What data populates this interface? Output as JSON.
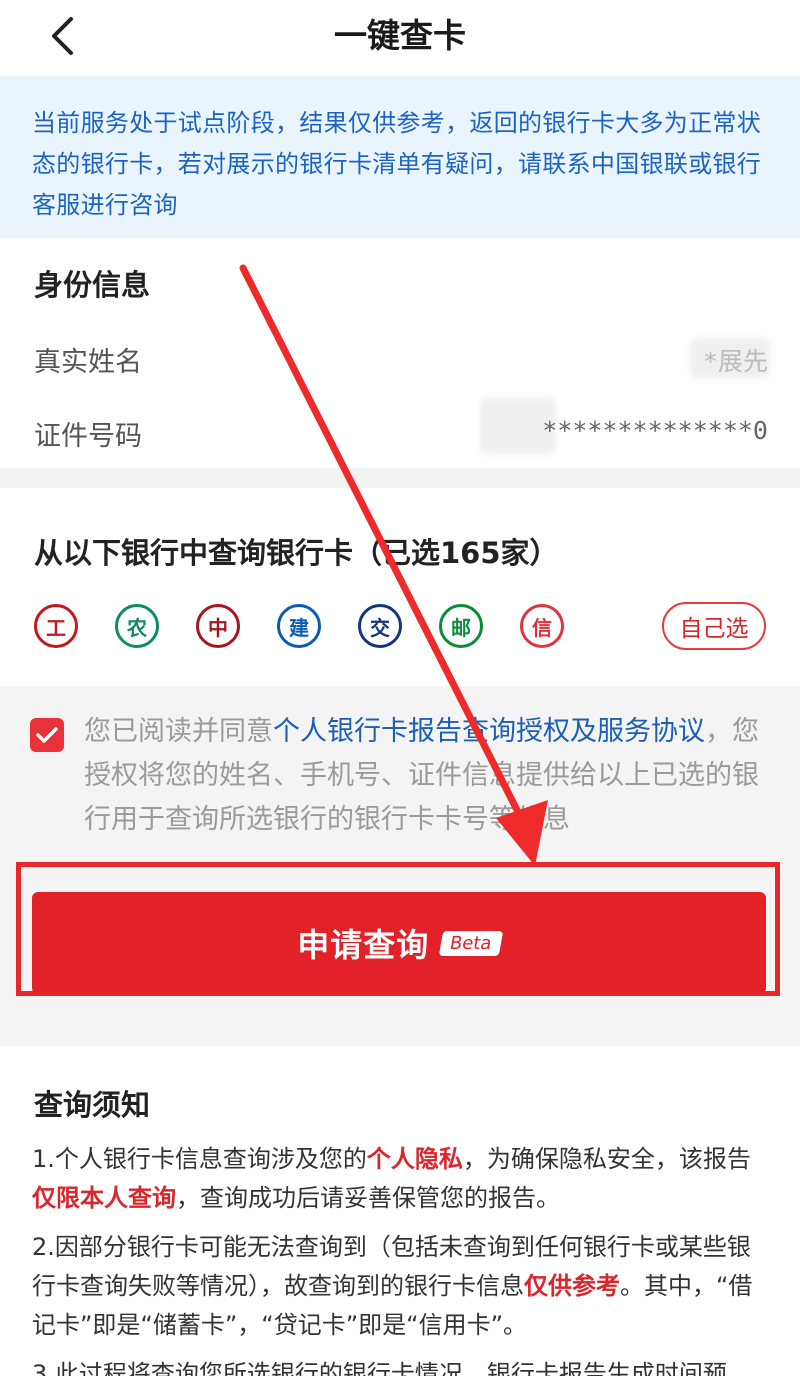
{
  "header": {
    "title": "一键查卡"
  },
  "notice": {
    "text": "当前服务处于试点阶段，结果仅供参考，返回的银行卡大多为正常状态的银行卡，若对展示的银行卡清单有疑问，请联系中国银联或银行客服进行咨询"
  },
  "identity": {
    "section_title": "身份信息",
    "name_label": "真实姓名",
    "name_value": "*展先",
    "id_label": "证件号码",
    "id_value": "**************0"
  },
  "banks": {
    "section_title": "从以下银行中查询银行卡（已选165家）",
    "custom_select_label": "自己选",
    "logos": [
      {
        "icon": "icbc-logo-icon",
        "color": "#c7161e",
        "glyph": "工"
      },
      {
        "icon": "abc-logo-icon",
        "color": "#0e8a67",
        "glyph": "农"
      },
      {
        "icon": "boc-logo-icon",
        "color": "#a8151c",
        "glyph": "中"
      },
      {
        "icon": "ccb-logo-icon",
        "color": "#0b5bb0",
        "glyph": "建"
      },
      {
        "icon": "bocom-logo-icon",
        "color": "#16357c",
        "glyph": "交"
      },
      {
        "icon": "psbc-logo-icon",
        "color": "#0d8b3a",
        "glyph": "邮"
      },
      {
        "icon": "citic-logo-icon",
        "color": "#e0343c",
        "glyph": "信"
      }
    ]
  },
  "agreement": {
    "text_before": "您已阅读并同意",
    "link_text": "个人银行卡报告查询授权及服务协议",
    "text_after": "，您授权将您的姓名、手机号、证件信息提供给以上已选的银行用于查询所选银行的银行卡卡号等信息",
    "checked": true
  },
  "apply": {
    "label": "申请查询",
    "badge": "Beta"
  },
  "notes": {
    "title": "查询须知",
    "item1_a": "1.个人银行卡信息查询涉及您的",
    "item1_hl1": "个人隐私",
    "item1_b": "，为确保隐私安全，该报告",
    "item1_hl2": "仅限本人查询",
    "item1_c": "，查询成功后请妥善保管您的报告。",
    "item2_a": "2.因部分银行卡可能无法查询到（包括未查询到任何银行卡或某些银行卡查询失败等情况），故查询到的银行卡信息",
    "item2_hl": "仅供参考",
    "item2_b": "。其中，“借记卡”即是“储蓄卡”，“贷记卡”即是“信用卡”。",
    "item3": "3.此过程将查询您所选银行的银行卡情况，银行卡报告生成时间预"
  },
  "colors": {
    "accent_red": "#e32128",
    "link_blue": "#1c5fb8",
    "notice_bg": "#eaf4fd"
  }
}
